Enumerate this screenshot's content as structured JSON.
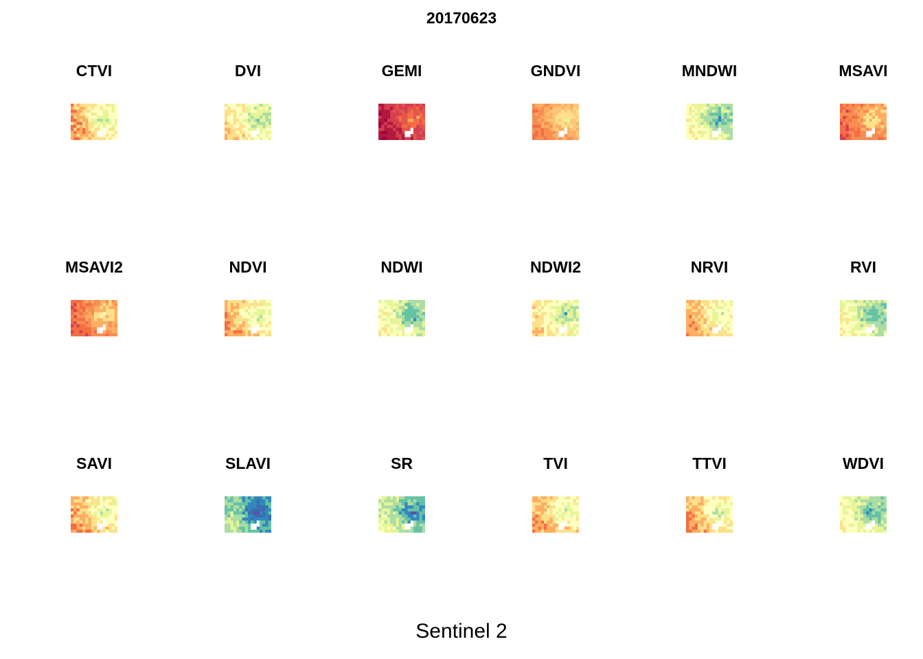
{
  "chart_data": {
    "type": "heatmap",
    "title": "20170623",
    "caption": "Sentinel 2",
    "panels": [
      {
        "name": "CTVI",
        "palette": [
          "#f46d43",
          "#fdae61",
          "#fee08b",
          "#ffffbf",
          "#e6f598",
          "#abdda4"
        ]
      },
      {
        "name": "DVI",
        "palette": [
          "#fdae61",
          "#fee08b",
          "#ffffbf",
          "#e6f598",
          "#abdda4",
          "#66c2a5"
        ]
      },
      {
        "name": "GEMI",
        "palette": [
          "#9e0142",
          "#b2183c",
          "#d53e4f",
          "#e4564a",
          "#f46d43",
          "#fdae61"
        ]
      },
      {
        "name": "GNDVI",
        "palette": [
          "#f46d43",
          "#f88d52",
          "#fdae61",
          "#fec67a",
          "#fee08b",
          "#e6f598"
        ]
      },
      {
        "name": "MNDWI",
        "palette": [
          "#fee08b",
          "#ffffbf",
          "#e6f598",
          "#abdda4",
          "#66c2a5",
          "#3288bd"
        ]
      },
      {
        "name": "MSAVI",
        "palette": [
          "#d53e4f",
          "#f46d43",
          "#f88d52",
          "#fdae61",
          "#fee08b",
          "#e6f598"
        ]
      },
      {
        "name": "MSAVI2",
        "palette": [
          "#d53e4f",
          "#f46d43",
          "#f88d52",
          "#fdae61",
          "#fee08b",
          "#ffffbf"
        ]
      },
      {
        "name": "NDVI",
        "palette": [
          "#f46d43",
          "#fdae61",
          "#fee08b",
          "#ffffbf",
          "#e6f598",
          "#abdda4"
        ]
      },
      {
        "name": "NDWI",
        "palette": [
          "#fee08b",
          "#ffffbf",
          "#e6f598",
          "#abdda4",
          "#66c2a5",
          "#3288bd"
        ]
      },
      {
        "name": "NDWI2",
        "palette": [
          "#fdae61",
          "#fee08b",
          "#ffffbf",
          "#e6f598",
          "#abdda4",
          "#3288bd"
        ]
      },
      {
        "name": "NRVI",
        "palette": [
          "#f46d43",
          "#fdae61",
          "#fee08b",
          "#ffffbf",
          "#e6f598",
          "#abdda4"
        ]
      },
      {
        "name": "RVI",
        "palette": [
          "#fee08b",
          "#ffffbf",
          "#e6f598",
          "#abdda4",
          "#66c2a5",
          "#3288bd"
        ]
      },
      {
        "name": "SAVI",
        "palette": [
          "#f46d43",
          "#fdae61",
          "#fee08b",
          "#ffffbf",
          "#e6f598",
          "#abdda4"
        ]
      },
      {
        "name": "SLAVI",
        "palette": [
          "#e6f598",
          "#abdda4",
          "#66c2a5",
          "#3288bd",
          "#3a6fb0",
          "#5e4fa2"
        ]
      },
      {
        "name": "SR",
        "palette": [
          "#ffffbf",
          "#e6f598",
          "#abdda4",
          "#66c2a5",
          "#3288bd",
          "#5e4fa2"
        ]
      },
      {
        "name": "TVI",
        "palette": [
          "#f46d43",
          "#fdae61",
          "#fee08b",
          "#ffffbf",
          "#e6f598",
          "#abdda4"
        ]
      },
      {
        "name": "TTVI",
        "palette": [
          "#f46d43",
          "#fdae61",
          "#fee08b",
          "#ffffbf",
          "#e6f598",
          "#abdda4"
        ]
      },
      {
        "name": "WDVI",
        "palette": [
          "#fee08b",
          "#ffffbf",
          "#e6f598",
          "#abdda4",
          "#66c2a5",
          "#3288bd"
        ]
      }
    ]
  }
}
